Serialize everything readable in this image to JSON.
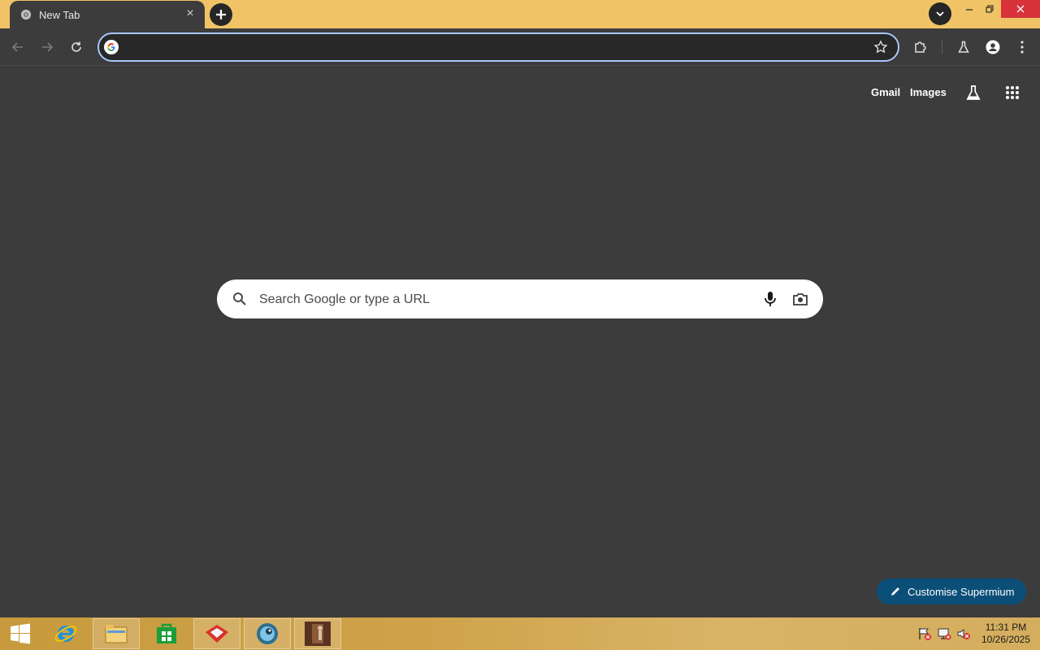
{
  "tab": {
    "title": "New Tab",
    "close_glyph": "×",
    "favicon": "chrome-icon"
  },
  "window_controls": {
    "minimize": "minimize-icon",
    "maximize": "restore-icon",
    "close": "close-icon"
  },
  "toolbar": {
    "back": "back-arrow-icon",
    "forward": "forward-arrow-icon",
    "reload": "reload-icon",
    "omnibox_value": "",
    "omnibox_placeholder": "",
    "bookmark": "star-icon",
    "extensions": "puzzle-icon",
    "labs": "flask-icon",
    "profile": "profile-icon",
    "menu": "kebab-menu-icon"
  },
  "ntp": {
    "gmail_label": "Gmail",
    "images_label": "Images",
    "search_placeholder": "Search Google or type a URL",
    "customise_label": "Customise Supermium"
  },
  "taskbar": {
    "items": [
      "start-button",
      "internet-explorer",
      "file-explorer",
      "store",
      "app-red",
      "browser-app",
      "app-thumbnail"
    ],
    "time": "11:31 PM",
    "date": "10/26/2025"
  },
  "colors": {
    "tabstrip": "#f0c466",
    "background": "#3c3c3c",
    "focus_ring": "#a8c7fa",
    "customise_button": "#0b4f78",
    "close_button": "#d8323a"
  }
}
